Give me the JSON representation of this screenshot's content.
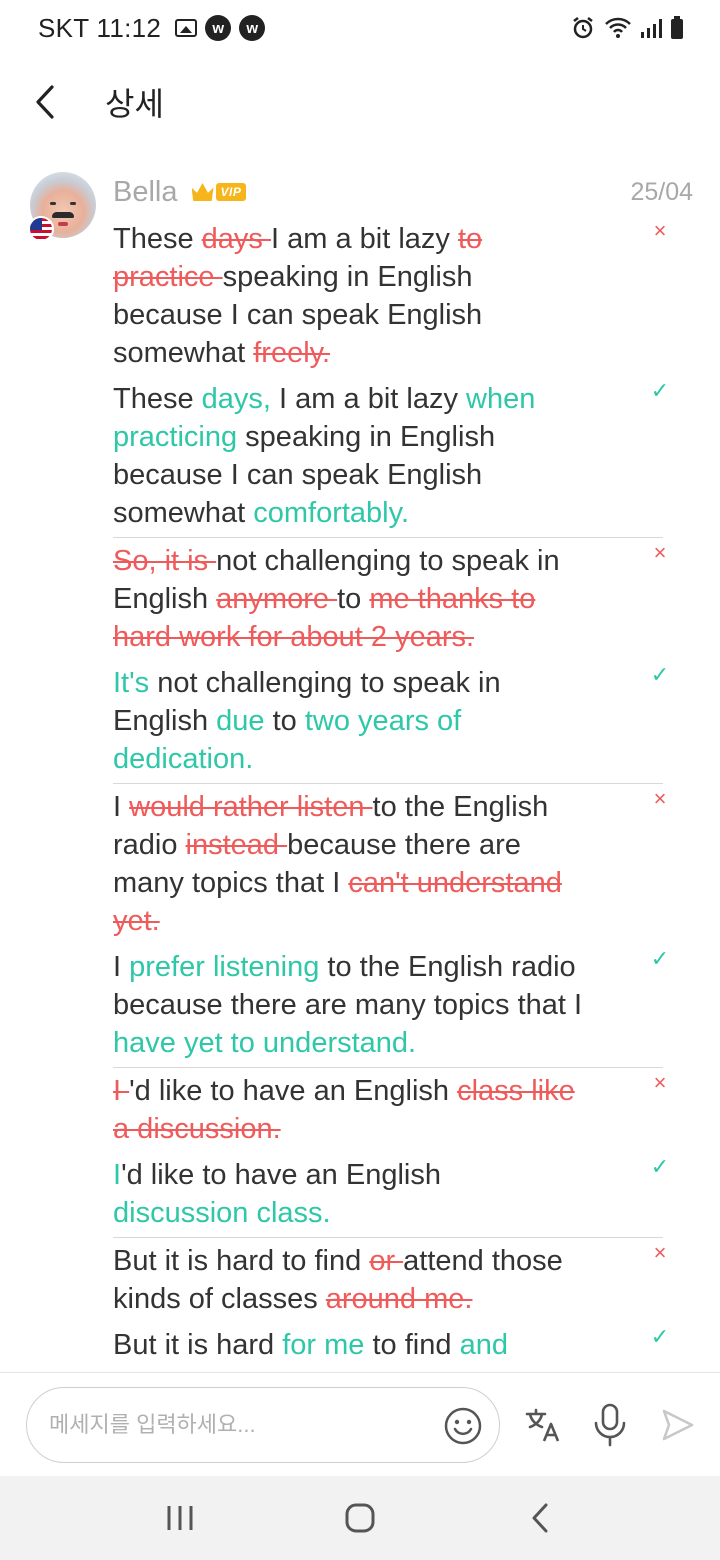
{
  "status_bar": {
    "time": "SKT 11:12",
    "icons": [
      "gallery-icon",
      "w-app-icon",
      "w-app-icon",
      "alarm-icon",
      "wifi-icon",
      "signal-icon",
      "battery-icon"
    ],
    "w_glyph": "w"
  },
  "header": {
    "title": "상세",
    "back_icon": "chevron-left-icon"
  },
  "message": {
    "user_name": "Bella",
    "vip_label": "VIP",
    "date": "25/04",
    "colors": {
      "deleted": "#ef5b5b",
      "added": "#2ec7a8"
    },
    "pairs": [
      {
        "original": [
          {
            "t": "These "
          },
          {
            "t": "days ",
            "s": "del"
          },
          {
            "t": "I am a bit lazy "
          },
          {
            "t": "to practice ",
            "s": "del"
          },
          {
            "t": "speaking in English because I can speak English somewhat "
          },
          {
            "t": "freely.",
            "s": "del"
          }
        ],
        "corrected": [
          {
            "t": "These "
          },
          {
            "t": "days,",
            "s": "add"
          },
          {
            "t": " I am a bit lazy "
          },
          {
            "t": "when practicing",
            "s": "add"
          },
          {
            "t": " speaking in English because I can speak English somewhat "
          },
          {
            "t": "comfortably.",
            "s": "add"
          }
        ]
      },
      {
        "original": [
          {
            "t": " So, it is ",
            "s": "del"
          },
          {
            "t": "not challenging to speak in English "
          },
          {
            "t": "anymore ",
            "s": "del"
          },
          {
            "t": "to "
          },
          {
            "t": "me thanks to hard work for about 2 years.",
            "s": "del"
          }
        ],
        "corrected": [
          {
            "t": "It's",
            "s": "add"
          },
          {
            "t": " not challenging to speak in English "
          },
          {
            "t": "due",
            "s": "add"
          },
          {
            "t": " to "
          },
          {
            "t": "two years of dedication.",
            "s": "add"
          }
        ]
      },
      {
        "original": [
          {
            "t": " ",
            "s": "del"
          },
          {
            "t": "I "
          },
          {
            "t": "would rather listen ",
            "s": "del"
          },
          {
            "t": "to the English radio "
          },
          {
            "t": "instead ",
            "s": "del"
          },
          {
            "t": "because there are many topics that I "
          },
          {
            "t": "can't understand yet.",
            "s": "del"
          }
        ],
        "corrected": [
          {
            "t": "I "
          },
          {
            "t": "prefer listening",
            "s": "add"
          },
          {
            "t": " to the English radio because there are many topics that I "
          },
          {
            "t": "have yet to understand.",
            "s": "add"
          }
        ]
      },
      {
        "original": [
          {
            "t": " I ",
            "s": "del"
          },
          {
            "t": "'d like to have an English "
          },
          {
            "t": "class like a discussion.",
            "s": "del"
          }
        ],
        "corrected": [
          {
            "t": "I",
            "s": "add"
          },
          {
            "t": "'d like to have an English "
          },
          {
            "t": "discussion class.",
            "s": "add"
          }
        ]
      },
      {
        "original": [
          {
            "t": " ",
            "s": "del"
          },
          {
            "t": "But it is hard to find "
          },
          {
            "t": "or ",
            "s": "del"
          },
          {
            "t": "attend those kinds of classes "
          },
          {
            "t": "around me.",
            "s": "del"
          }
        ],
        "corrected": [
          {
            "t": "But it is hard "
          },
          {
            "t": "for me",
            "s": "add"
          },
          {
            "t": " to find "
          },
          {
            "t": "and",
            "s": "add"
          }
        ]
      }
    ],
    "wrong_mark": "×",
    "right_mark": "✓"
  },
  "composer": {
    "placeholder": "메세지를 입력하세요...",
    "tools": [
      "emoji-icon",
      "translate-icon",
      "microphone-icon",
      "send-icon"
    ]
  },
  "nav": [
    "recent-apps-icon",
    "home-icon",
    "back-icon"
  ]
}
